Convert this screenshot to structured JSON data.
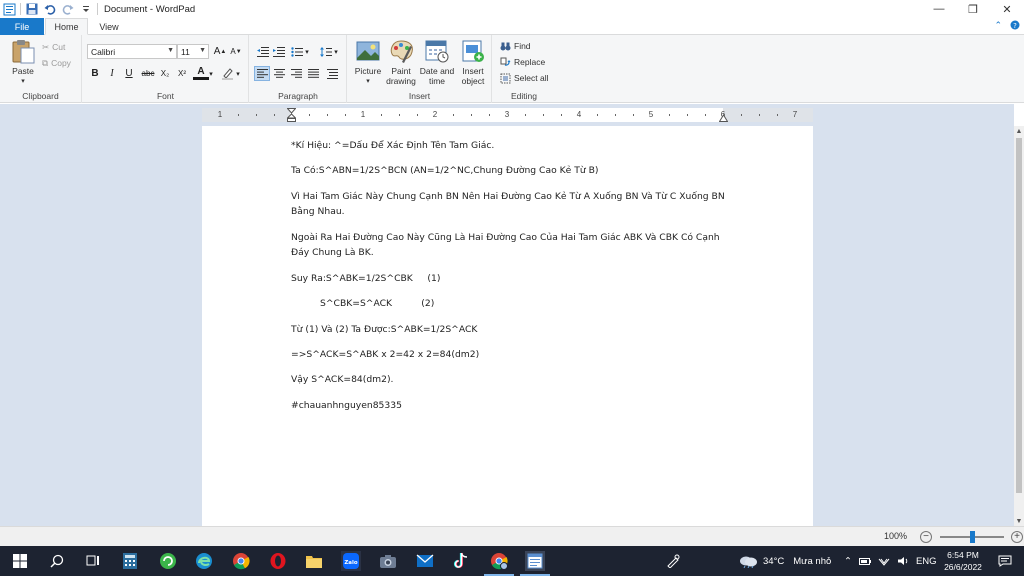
{
  "window": {
    "title": "Document - WordPad",
    "minimize": "—",
    "restore": "❐",
    "close": "✕"
  },
  "tabs": {
    "file": "File",
    "home": "Home",
    "view": "View"
  },
  "ribbon": {
    "clipboard": {
      "label": "Clipboard",
      "paste": "Paste",
      "cut": "Cut",
      "copy": "Copy"
    },
    "font": {
      "label": "Font",
      "family": "Calibri",
      "size": "11",
      "bold": "B",
      "italic": "I",
      "underline": "U",
      "strike": "abc",
      "subscript": "X₂",
      "superscript": "X²",
      "font_color": "A"
    },
    "paragraph": {
      "label": "Paragraph"
    },
    "insert": {
      "label": "Insert",
      "picture": "Picture",
      "paint_drawing": [
        "Paint",
        "drawing"
      ],
      "date_time": [
        "Date and",
        "time"
      ],
      "insert_object": [
        "Insert",
        "object"
      ]
    },
    "editing": {
      "label": "Editing",
      "find": "Find",
      "replace": "Replace",
      "select_all": "Select all"
    }
  },
  "ruler": {
    "numbers": [
      "1",
      "1",
      "2",
      "3",
      "4",
      "5",
      "6",
      "7"
    ]
  },
  "document": {
    "paragraphs": [
      "*Kí Hiệu: ^=Dấu Để Xác Định Tên Tam Giác.",
      "Ta Có:S^ABN=1/2S^BCN (AN=1/2^NC,Chung Đường Cao Kẻ Từ B)",
      "Vì Hai Tam Giác Này Chung Cạnh BN Nên Hai Đường Cao Kẻ Từ A Xuống BN Và Từ C Xuống BN Bằng Nhau.",
      "Ngoài Ra Hai Đường Cao Này Cũng Là Hai Đường Cao Của Hai Tam Giác ABK Và CBK Có Cạnh Đáy Chung Là BK.",
      "Suy Ra:S^ABK=1/2S^CBK     (1)",
      "S^CBK=S^ACK          (2)",
      "Từ (1) Và (2) Ta Được:S^ABK=1/2S^ACK",
      "=>S^ACK=S^ABK x 2=42 x 2=84(dm2)",
      "Vậy S^ACK=84(dm2).",
      "#chauanhnguyen85335"
    ]
  },
  "status": {
    "zoom": "100%",
    "zoom_level": 0.5,
    "minus": "−",
    "plus": "+"
  },
  "taskbar": {
    "weather_temp": "34°C",
    "weather_text": "Mưa nhỏ",
    "language": "ENG",
    "time": "6:54 PM",
    "date": "26/6/2022",
    "zalo_label": "Zalo"
  },
  "colors": {
    "accent": "#1979ca",
    "taskbar": "#1d2331",
    "workspace": "#d8e1ee"
  }
}
